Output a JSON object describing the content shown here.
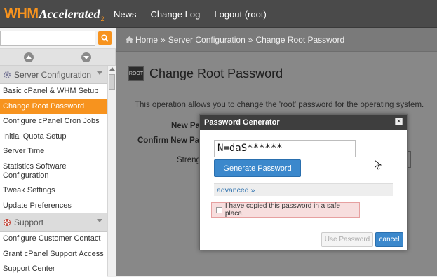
{
  "topbar": {
    "logo_whm": "WHM",
    "logo_accelerated": "Accelerated",
    "logo_version": "2",
    "nav": [
      "News",
      "Change Log",
      "Logout (root)"
    ]
  },
  "sidebar": {
    "search_placeholder": "",
    "sections": [
      {
        "label": "Server Configuration"
      },
      {
        "label": "Support"
      }
    ],
    "server_items": [
      "Basic cPanel & WHM Setup",
      "Change Root Password",
      "Configure cPanel Cron Jobs",
      "Initial Quota Setup",
      "Server Time",
      "Statistics Software Configuration",
      "Tweak Settings",
      "Update Preferences"
    ],
    "support_items": [
      "Configure Customer Contact",
      "Grant cPanel Support Access",
      "Support Center"
    ]
  },
  "breadcrumb": [
    "Home",
    "Server Configuration",
    "Change Root Password"
  ],
  "breadcrumb_sep": "»",
  "page": {
    "icon_text": "ROOT",
    "title": "Change Root Password",
    "description": "This operation allows you to change the 'root' password for the operating system.",
    "label_new": "New Pa",
    "label_confirm": "Confirm New Pa",
    "label_strength": "Streng"
  },
  "modal": {
    "title": "Password Generator",
    "close": "×",
    "password_value": "N=daS******",
    "generate_label": "Generate Password",
    "advanced_label": "advanced »",
    "copied_label": "I have copied this password in a safe place.",
    "use_label": "Use Password",
    "cancel_label": "cancel"
  },
  "colors": {
    "accent": "#f7931e",
    "primary": "#3b88cc",
    "topbar": "#4a4a4a"
  }
}
